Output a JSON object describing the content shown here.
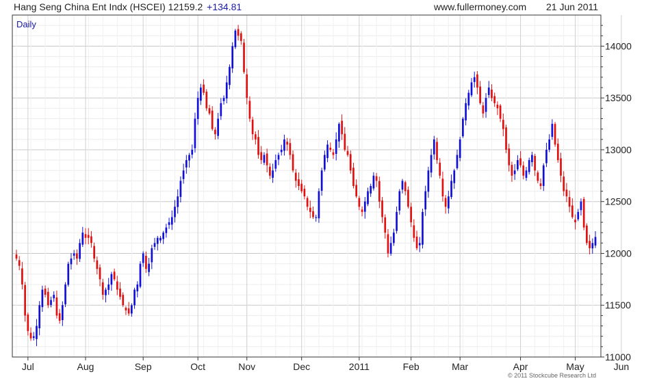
{
  "header": {
    "title": "Hang Seng China Ent Indx (HSCEI) 12159.2",
    "change": "+134.81",
    "site": "www.fullermoney.com",
    "date": "21 Jun 2011"
  },
  "footer": {
    "copyright": "© 2011 Stockcube Research Ltd"
  },
  "colors": {
    "up": "#1010d8",
    "down": "#e01010",
    "grid": "#dddddd",
    "frame": "#333333",
    "accent": "#1a1aa8"
  },
  "chart_data": {
    "type": "candlestick",
    "period_label": "Daily",
    "title": "Hang Seng China Ent Indx (HSCEI)",
    "last": 12159.2,
    "change": 134.81,
    "ylim": [
      11000,
      14300
    ],
    "yticks": [
      11000,
      11500,
      12000,
      12500,
      13000,
      13500,
      14000
    ],
    "y_axis_side": "right",
    "grid": true,
    "x_ticks": [
      {
        "label": "Jul",
        "index": 4
      },
      {
        "label": "Aug",
        "index": 24
      },
      {
        "label": "Sep",
        "index": 44
      },
      {
        "label": "Oct",
        "index": 63
      },
      {
        "label": "Nov",
        "index": 80
      },
      {
        "label": "Dec",
        "index": 99
      },
      {
        "label": "2011",
        "index": 119
      },
      {
        "label": "Feb",
        "index": 137
      },
      {
        "label": "Mar",
        "index": 154
      },
      {
        "label": "Apr",
        "index": 175
      },
      {
        "label": "May",
        "index": 194
      },
      {
        "label": "Jun",
        "index": 210
      }
    ],
    "close": [
      11950,
      11880,
      11700,
      11400,
      11250,
      11180,
      11200,
      11300,
      11500,
      11650,
      11600,
      11500,
      11550,
      11600,
      11400,
      11350,
      11500,
      11700,
      11900,
      11950,
      12000,
      11950,
      12100,
      12200,
      12150,
      12150,
      12100,
      11950,
      11850,
      11750,
      11600,
      11650,
      11700,
      11800,
      11750,
      11650,
      11580,
      11500,
      11450,
      11420,
      11500,
      11650,
      11700,
      11900,
      12000,
      11850,
      11900,
      12050,
      12100,
      12150,
      12150,
      12200,
      12250,
      12300,
      12350,
      12450,
      12550,
      12700,
      12800,
      12900,
      12950,
      13000,
      13300,
      13500,
      13600,
      13550,
      13400,
      13350,
      13200,
      13150,
      13300,
      13450,
      13500,
      13650,
      13800,
      14000,
      14150,
      14100,
      14050,
      13750,
      13500,
      13300,
      13150,
      13100,
      12950,
      12900,
      12950,
      12850,
      12750,
      12800,
      12900,
      12950,
      13000,
      13100,
      13050,
      12950,
      12800,
      12700,
      12650,
      12600,
      12550,
      12450,
      12400,
      12350,
      12350,
      12600,
      12800,
      12950,
      13050,
      13000,
      12950,
      13100,
      13250,
      13150,
      13000,
      12950,
      12800,
      12650,
      12550,
      12450,
      12400,
      12500,
      12600,
      12650,
      12750,
      12700,
      12500,
      12350,
      12200,
      12000,
      12100,
      12200,
      12400,
      12600,
      12700,
      12600,
      12450,
      12300,
      12150,
      12050,
      12100,
      12400,
      12600,
      12800,
      12950,
      13100,
      12900,
      12750,
      12550,
      12450,
      12550,
      12700,
      12800,
      12950,
      13100,
      13300,
      13450,
      13550,
      13650,
      13700,
      13600,
      13450,
      13350,
      13500,
      13600,
      13500,
      13450,
      13400,
      13300,
      13200,
      13000,
      12850,
      12750,
      12800,
      12900,
      12850,
      12750,
      12800,
      12900,
      12950,
      12800,
      12700,
      12650,
      12850,
      13000,
      13100,
      13250,
      13050,
      12900,
      12750,
      12600,
      12550,
      12450,
      12350,
      12300,
      12400,
      12500,
      12250,
      12100,
      12050,
      12100,
      12159
    ]
  }
}
